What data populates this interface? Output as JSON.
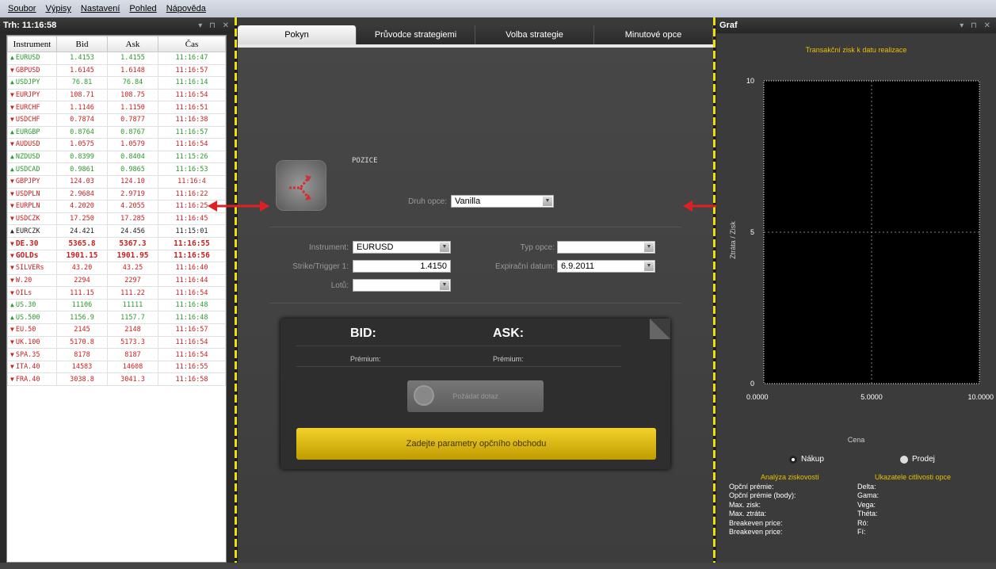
{
  "menu": [
    "Soubor",
    "Výpisy",
    "Nastavení",
    "Pohled",
    "Nápověda"
  ],
  "market": {
    "title": "Trh: 11:16:58",
    "controls": "▾ ⊓ ✕",
    "headers": [
      "Instrument",
      "Bid",
      "Ask",
      "Čas"
    ],
    "rows": [
      {
        "instrument": "EURUSD",
        "bid": "1.4153",
        "ask": "1.4155",
        "time": "11:16:47",
        "dir": "up"
      },
      {
        "instrument": "GBPUSD",
        "bid": "1.6145",
        "ask": "1.6148",
        "time": "11:16:57",
        "dir": "down"
      },
      {
        "instrument": "USDJPY",
        "bid": "76.81",
        "ask": "76.84",
        "time": "11:16:14",
        "dir": "up"
      },
      {
        "instrument": "EURJPY",
        "bid": "108.71",
        "ask": "108.75",
        "time": "11:16:54",
        "dir": "down"
      },
      {
        "instrument": "EURCHF",
        "bid": "1.1146",
        "ask": "1.1150",
        "time": "11:16:51",
        "dir": "down"
      },
      {
        "instrument": "USDCHF",
        "bid": "0.7874",
        "ask": "0.7877",
        "time": "11:16:38",
        "dir": "down"
      },
      {
        "instrument": "EURGBP",
        "bid": "0.8764",
        "ask": "0.8767",
        "time": "11:16:57",
        "dir": "up"
      },
      {
        "instrument": "AUDUSD",
        "bid": "1.0575",
        "ask": "1.0579",
        "time": "11:16:54",
        "dir": "down"
      },
      {
        "instrument": "NZDUSD",
        "bid": "0.8399",
        "ask": "0.8404",
        "time": "11:15:26",
        "dir": "up"
      },
      {
        "instrument": "USDCAD",
        "bid": "0.9861",
        "ask": "0.9865",
        "time": "11:16:53",
        "dir": "up"
      },
      {
        "instrument": "GBPJPY",
        "bid": "124.03",
        "ask": "124.10",
        "time": "11:16:4",
        "dir": "down"
      },
      {
        "instrument": "USDPLN",
        "bid": "2.9684",
        "ask": "2.9719",
        "time": "11:16:22",
        "dir": "down"
      },
      {
        "instrument": "EURPLN",
        "bid": "4.2020",
        "ask": "4.2055",
        "time": "11:16:25",
        "dir": "down"
      },
      {
        "instrument": "USDCZK",
        "bid": "17.250",
        "ask": "17.285",
        "time": "11:16:45",
        "dir": "down"
      },
      {
        "instrument": "EURCZK",
        "bid": "24.421",
        "ask": "24.456",
        "time": "11:15:01",
        "dir": "up",
        "dark": true
      },
      {
        "instrument": "DE.30",
        "bid": "5365.8",
        "ask": "5367.3",
        "time": "11:16:55",
        "dir": "down",
        "bold": true
      },
      {
        "instrument": "GOLDs",
        "bid": "1901.15",
        "ask": "1901.95",
        "time": "11:16:56",
        "dir": "down",
        "bold": true
      },
      {
        "instrument": "SILVERs",
        "bid": "43.20",
        "ask": "43.25",
        "time": "11:16:40",
        "dir": "down"
      },
      {
        "instrument": "W.20",
        "bid": "2294",
        "ask": "2297",
        "time": "11:16:44",
        "dir": "down"
      },
      {
        "instrument": "OILs",
        "bid": "111.15",
        "ask": "111.22",
        "time": "11:16:54",
        "dir": "down"
      },
      {
        "instrument": "US.30",
        "bid": "11106",
        "ask": "11111",
        "time": "11:16:48",
        "dir": "up"
      },
      {
        "instrument": "US.500",
        "bid": "1156.9",
        "ask": "1157.7",
        "time": "11:16:48",
        "dir": "up"
      },
      {
        "instrument": "EU.50",
        "bid": "2145",
        "ask": "2148",
        "time": "11:16:57",
        "dir": "down"
      },
      {
        "instrument": "UK.100",
        "bid": "5170.8",
        "ask": "5173.3",
        "time": "11:16:54",
        "dir": "down"
      },
      {
        "instrument": "SPA.35",
        "bid": "8178",
        "ask": "8187",
        "time": "11:16:54",
        "dir": "down"
      },
      {
        "instrument": "ITA.40",
        "bid": "14583",
        "ask": "14608",
        "time": "11:16:55",
        "dir": "down"
      },
      {
        "instrument": "FRA.40",
        "bid": "3038.8",
        "ask": "3041.3",
        "time": "11:16:58",
        "dir": "down"
      }
    ]
  },
  "tabs": [
    "Pokyn",
    "Průvodce strategiemi",
    "Volba strategie",
    "Minutové opce"
  ],
  "order": {
    "section": "POZICE",
    "option_type_label": "Druh opce:",
    "option_type_value": "Vanilla",
    "instrument_label": "Instrument:",
    "instrument_value": "EURUSD",
    "typ_label": "Typ opce:",
    "typ_value": "",
    "strike_label": "Strike/Trigger 1:",
    "strike_value": "1.4150",
    "expiry_label": "Expirační datum:",
    "expiry_value": "6.9.2011",
    "lots_label": "Lotů:",
    "lots_value": "",
    "bid_label": "BID:",
    "ask_label": "ASK:",
    "premium_label": "Prémium:",
    "quote_button": "Požádat dotaz",
    "submit_button": "Zadejte parametry opčního obchodu"
  },
  "graph": {
    "title": "Graf",
    "controls": "▾ ⊓ ✕",
    "buy_label": "Nákup",
    "sell_label": "Prodej",
    "profit_title": "Analýza ziskovosti",
    "profit_rows": [
      "Opční prémie:",
      "Opční prémie (body):",
      "Max. zisk:",
      "Max. ztráta:",
      "Breakeven price:",
      "Breakeven price:"
    ],
    "sens_title": "Ukazatele citlivosti opce",
    "sens_rows": [
      "Delta:",
      "Gama:",
      "Vega:",
      "Théta:",
      "Ró:",
      "Fí:"
    ]
  },
  "chart_data": {
    "type": "line",
    "title": "Transakční zisk k datu realizace",
    "xlabel": "Cena",
    "ylabel": "Ztráta / Zisk",
    "xlim": [
      0,
      10
    ],
    "ylim": [
      0,
      10
    ],
    "x_ticks": [
      "0.0000",
      "5.0000",
      "10.0000"
    ],
    "y_ticks": [
      "0",
      "5",
      "10"
    ],
    "series": []
  },
  "colors": {
    "up": "#2a9a2a",
    "down": "#c82020",
    "accent": "#e8c000",
    "arrow": "#e02020"
  }
}
